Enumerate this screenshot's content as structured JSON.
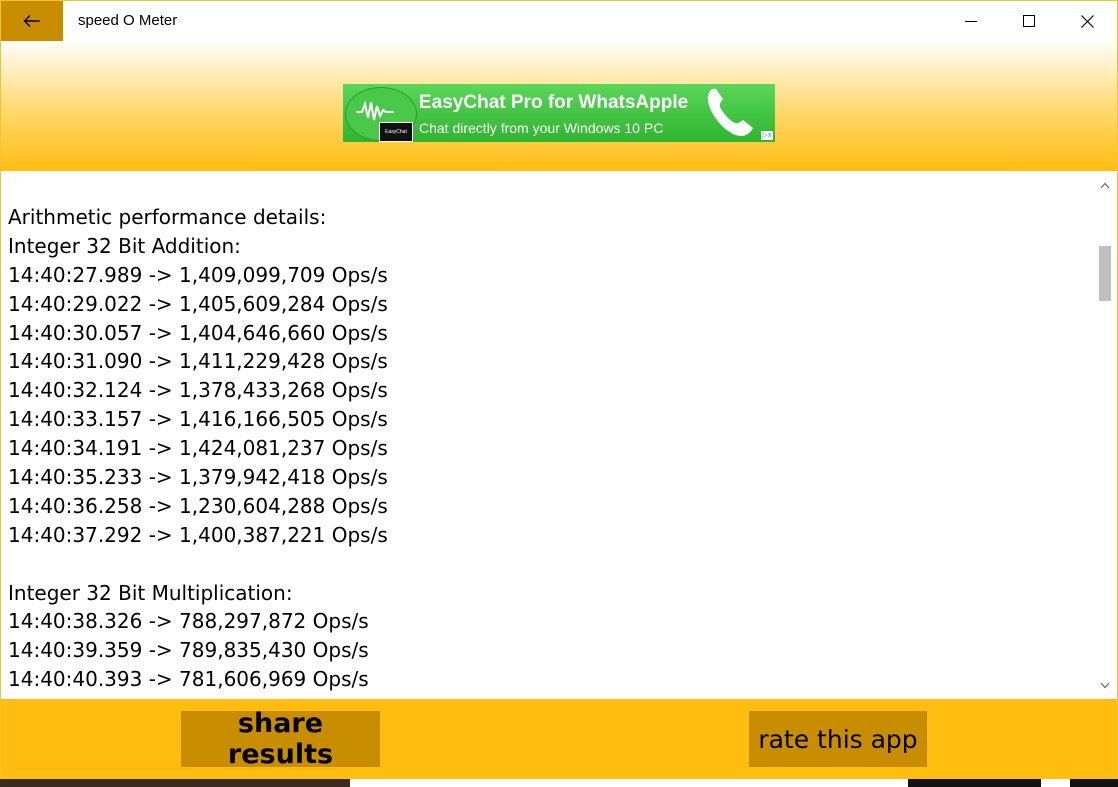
{
  "window": {
    "title": "speed O Meter"
  },
  "ad": {
    "title": "EasyChat Pro for WhatsApple",
    "subtitle": "Chat directly from your Windows 10 PC",
    "badge": "EasyChat"
  },
  "log": {
    "lines": [
      "Arithmetic performance details:",
      "Integer 32 Bit Addition:",
      "14:40:27.989 -> 1,409,099,709 Ops/s",
      "14:40:29.022 -> 1,405,609,284 Ops/s",
      "14:40:30.057 -> 1,404,646,660 Ops/s",
      "14:40:31.090 -> 1,411,229,428 Ops/s",
      "14:40:32.124 -> 1,378,433,268 Ops/s",
      "14:40:33.157 -> 1,416,166,505 Ops/s",
      "14:40:34.191 -> 1,424,081,237 Ops/s",
      "14:40:35.233 -> 1,379,942,418 Ops/s",
      "14:40:36.258 -> 1,230,604,288 Ops/s",
      "14:40:37.292 -> 1,400,387,221 Ops/s",
      "",
      "Integer 32 Bit Multiplication:",
      "14:40:38.326 -> 788,297,872 Ops/s",
      "14:40:39.359 -> 789,835,430 Ops/s",
      "14:40:40.393 -> 781,606,969 Ops/s"
    ]
  },
  "footer": {
    "share_label": "share results",
    "rate_label": "rate this app"
  },
  "colors": {
    "accent": "#ffbd10",
    "button": "#c98e00",
    "ad_green": "#3dbb3b"
  },
  "icons": {
    "back": "arrow-left-icon",
    "minimize": "minimize-icon",
    "maximize": "maximize-icon",
    "close": "close-icon",
    "scroll_up": "chevron-up-icon",
    "scroll_down": "chevron-down-icon"
  }
}
